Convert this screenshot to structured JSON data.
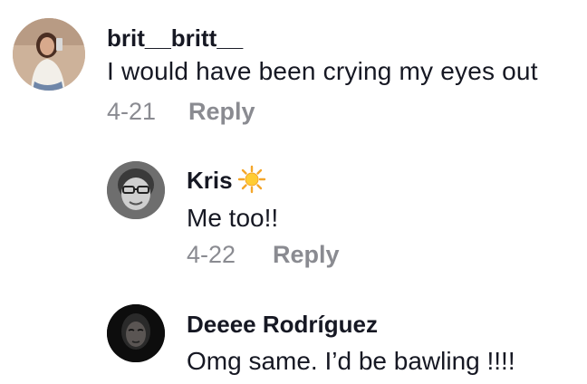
{
  "comments": [
    {
      "username": "brit__britt__",
      "text": "I would have been crying my eyes out",
      "date": "4-21",
      "reply_label": "Reply"
    },
    {
      "username": "Kris",
      "text": "Me too!!",
      "date": "4-22",
      "reply_label": "Reply",
      "badge_icon": "sun-icon"
    },
    {
      "username": "Deeee Rodríguez",
      "text": "Omg same. I’d be bawling !!!!"
    }
  ],
  "colors": {
    "text_primary": "#161823",
    "text_secondary": "#8a8b91",
    "background": "#ffffff"
  }
}
